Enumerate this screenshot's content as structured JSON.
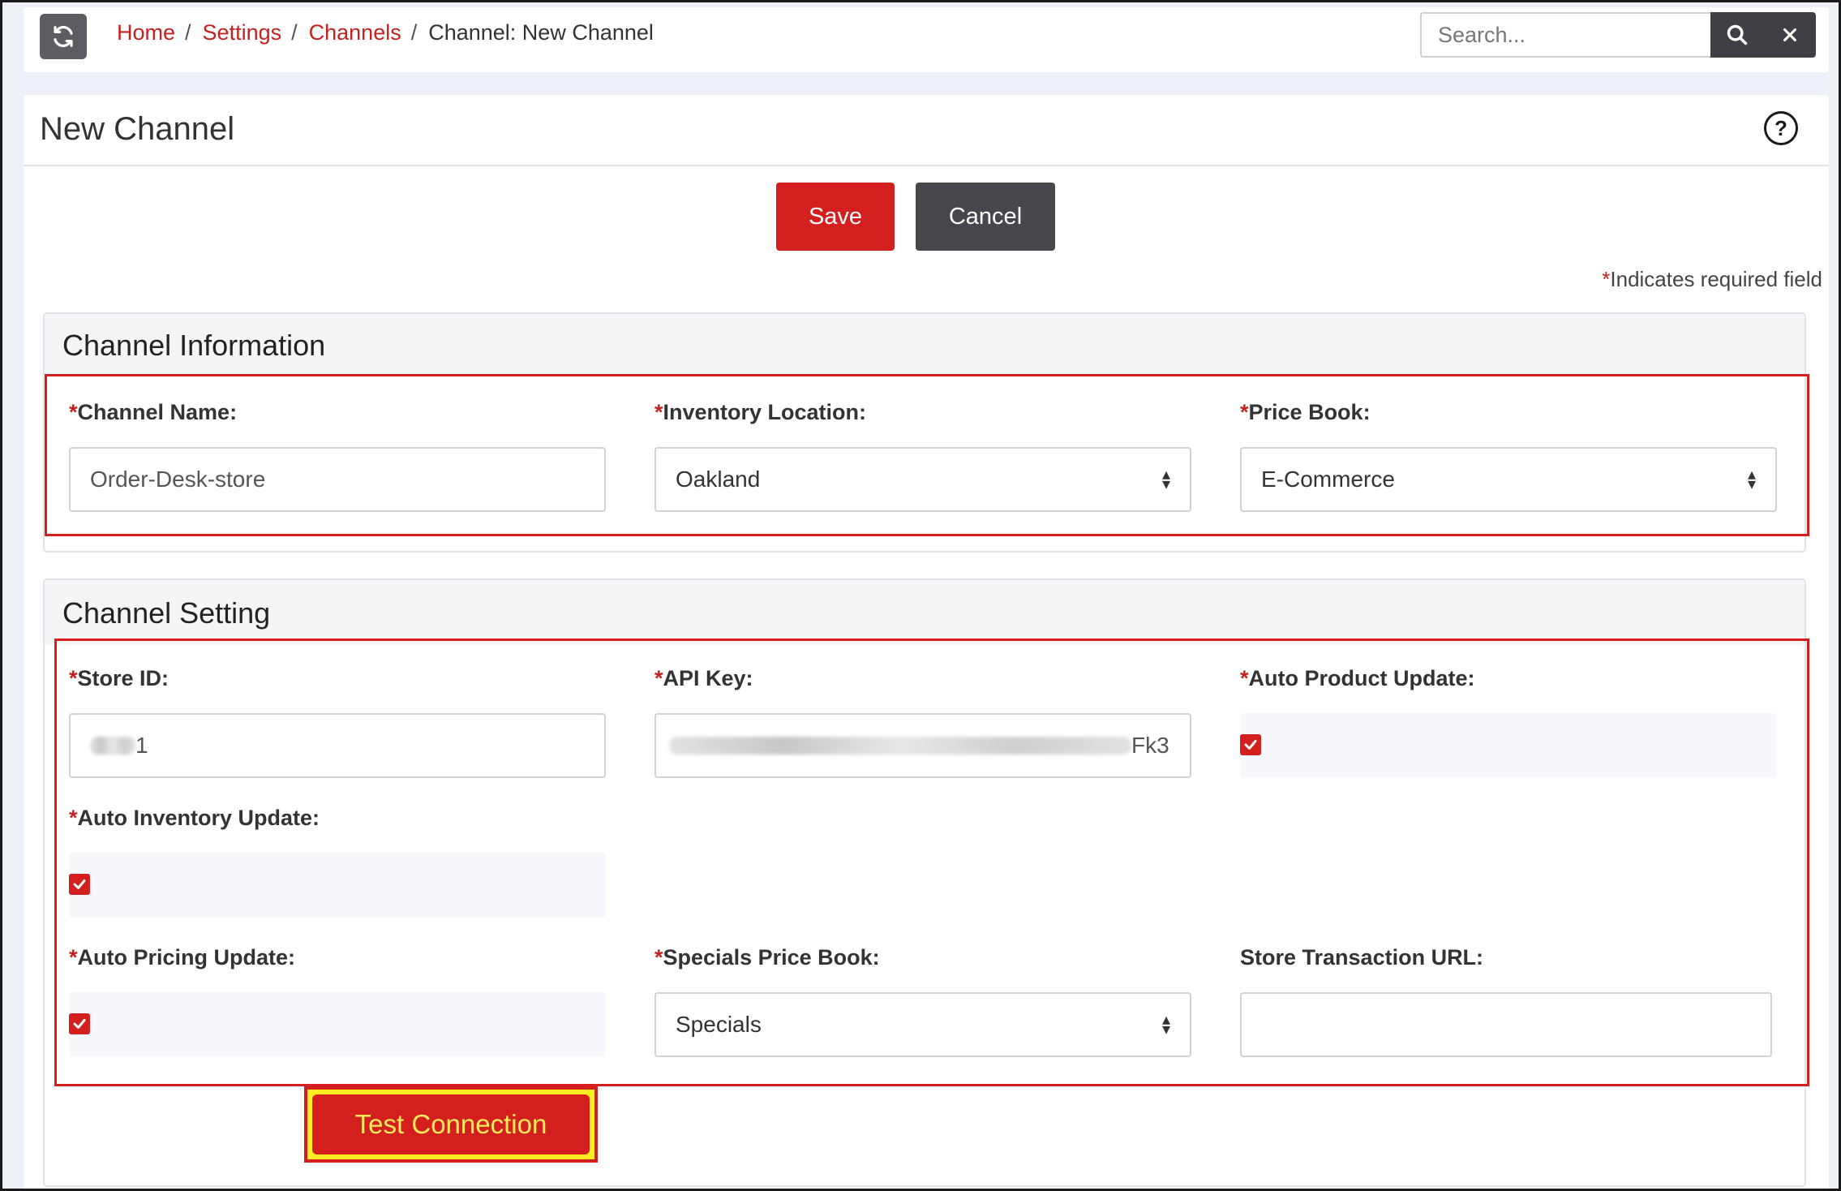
{
  "breadcrumb": {
    "home": "Home",
    "settings": "Settings",
    "channels": "Channels",
    "current": "Channel: New Channel",
    "separator": "/"
  },
  "search": {
    "placeholder": "Search...",
    "search_icon": "search-icon",
    "clear_icon": "close-icon"
  },
  "page": {
    "title": "New Channel",
    "help_icon": "?"
  },
  "actions": {
    "save_label": "Save",
    "cancel_label": "Cancel"
  },
  "required_note": {
    "star": "*",
    "text": "Indicates required field"
  },
  "channel_information": {
    "title": "Channel Information",
    "channel_name": {
      "label": "Channel Name:",
      "value": "Order-Desk-store"
    },
    "inventory_location": {
      "label": "Inventory Location:",
      "value": "Oakland"
    },
    "price_book": {
      "label": "Price Book:",
      "value": "E-Commerce"
    }
  },
  "channel_setting": {
    "title": "Channel Setting",
    "store_id": {
      "label": "Store ID:",
      "value_visible": "1"
    },
    "api_key": {
      "label": "API Key:",
      "value_visible": "Fk3"
    },
    "auto_product_update": {
      "label": "Auto Product Update:",
      "checked": true
    },
    "auto_inventory_update": {
      "label": "Auto Inventory Update:",
      "checked": true
    },
    "auto_pricing_update": {
      "label": "Auto Pricing Update:",
      "checked": true
    },
    "specials_price_book": {
      "label": "Specials Price Book:",
      "value": "Specials"
    },
    "store_transaction_url": {
      "label": "Store Transaction URL:",
      "value": ""
    }
  },
  "test_connection_label": "Test Connection",
  "colors": {
    "accent_red": "#d3201f",
    "dark_button": "#45474c",
    "highlight_yellow": "#ffee22"
  }
}
